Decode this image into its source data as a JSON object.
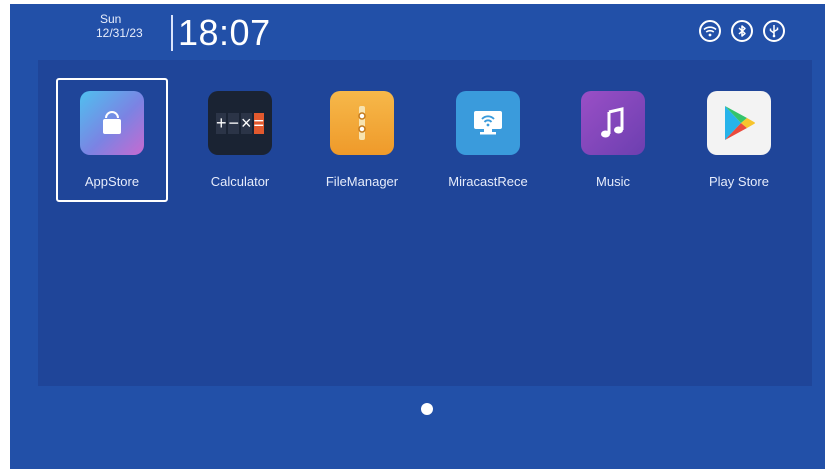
{
  "status": {
    "day": "Sun",
    "date": "12/31/23",
    "time": "18:07",
    "icons": [
      "wifi-icon",
      "bluetooth-icon",
      "usb-icon"
    ]
  },
  "apps": [
    {
      "label": "AppStore",
      "icon": "shopping-bag-icon",
      "selected": true
    },
    {
      "label": "Calculator",
      "icon": "calculator-icon"
    },
    {
      "label": "FileManager",
      "icon": "folder-icon"
    },
    {
      "label": "MiracastRece",
      "icon": "cast-monitor-icon"
    },
    {
      "label": "Music",
      "icon": "music-note-icon"
    },
    {
      "label": "Play Store",
      "icon": "play-store-icon"
    }
  ],
  "calculator_symbols": [
    "+",
    "−",
    "×",
    "="
  ],
  "pager": {
    "pages": 1,
    "current": 1
  },
  "colors": {
    "background": "#2250a8",
    "panel": "#1f4599",
    "accent": "#ffffff"
  }
}
